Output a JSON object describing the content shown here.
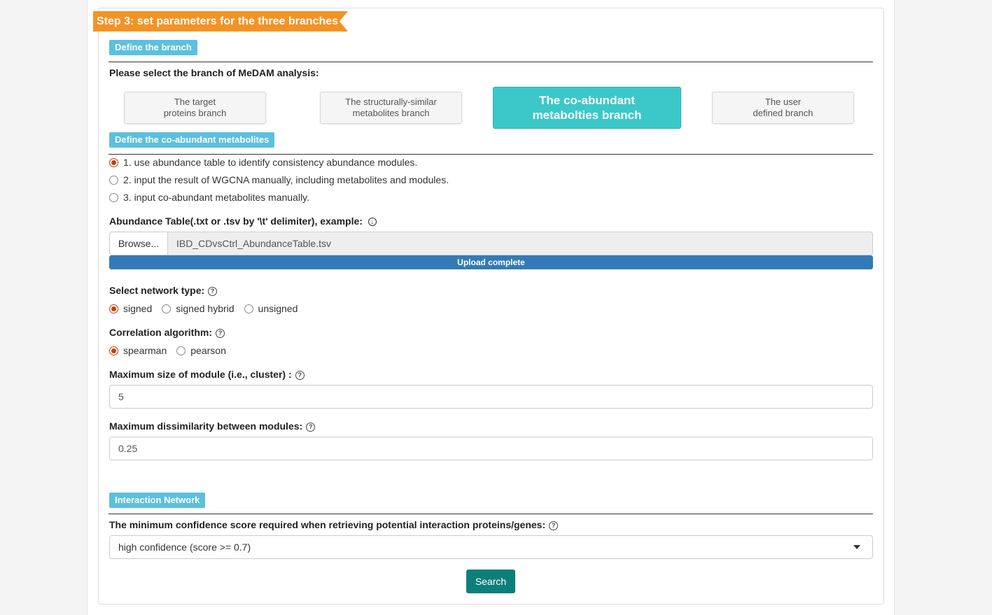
{
  "step": {
    "title": "Step 3: set parameters for the three branches"
  },
  "branch_section": {
    "label": "Define the branch",
    "prompt": "Please select the branch of MeDAM analysis:",
    "buttons": [
      {
        "label": "The target\nproteins branch",
        "active": false
      },
      {
        "label": "The structurally-similar\nmetabolites branch",
        "active": false
      },
      {
        "label": "The co-abundant\nmetabolties branch",
        "active": true
      },
      {
        "label": "The user\ndefined branch",
        "active": false
      }
    ]
  },
  "coabundant_section": {
    "label": "Define the co-abundant metabolites",
    "options": [
      {
        "label": "1. use abundance table to identify consistency abundance modules.",
        "checked": true
      },
      {
        "label": "2. input the result of WGCNA manually, including metabolites and modules.",
        "checked": false
      },
      {
        "label": "3. input co-abundant metabolites manually.",
        "checked": false
      }
    ]
  },
  "abundance_table": {
    "label": "Abundance Table(.txt or .tsv by '\\t' delimiter), example:",
    "browse_label": "Browse...",
    "file_name": "IBD_CDvsCtrl_AbundanceTable.tsv",
    "progress_text": "Upload complete",
    "progress": 1.0
  },
  "network_type": {
    "label": "Select network type:",
    "options": [
      {
        "label": "signed",
        "checked": true
      },
      {
        "label": "signed hybrid",
        "checked": false
      },
      {
        "label": "unsigned",
        "checked": false
      }
    ]
  },
  "correlation": {
    "label": "Correlation algorithm:",
    "options": [
      {
        "label": "spearman",
        "checked": true
      },
      {
        "label": "pearson",
        "checked": false
      }
    ]
  },
  "max_module_size": {
    "label": "Maximum size of module (i.e., cluster) :",
    "value": "5"
  },
  "max_dissimilarity": {
    "label": "Maximum dissimilarity between modules:",
    "value": "0.25"
  },
  "interaction_section": {
    "label": "Interaction Network",
    "confidence_label": "The minimum confidence score required when retrieving potential interaction proteins/genes:",
    "confidence_value": "high confidence (score >= 0.7)"
  },
  "search_button": {
    "label": "Search"
  },
  "colors": {
    "ribbon": "#f39325",
    "section_label": "#5bc0de",
    "active_branch": "#3cc8c8",
    "progress": "#337ab7",
    "search": "#0c7f7a",
    "radio_checked": "#c2410c"
  }
}
